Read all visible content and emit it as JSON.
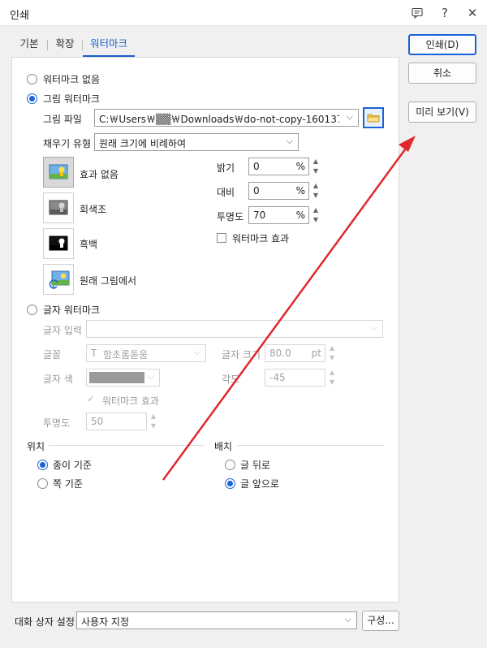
{
  "window": {
    "title": "인쇄"
  },
  "tabs": [
    {
      "label": "기본"
    },
    {
      "label": "확장"
    },
    {
      "label": "워터마크"
    }
  ],
  "watermark": {
    "none_label": "워터마크 없음",
    "image_label": "그림 워터마크",
    "image_file_label": "그림 파일",
    "image_file_value": "C:￦Users￦▒▒￦Downloads￦do-not-copy-160137…",
    "fill_type_label": "채우기 유형",
    "fill_type_value": "원래 크기에 비례하여",
    "effects": [
      {
        "label": "효과 없음"
      },
      {
        "label": "회색조"
      },
      {
        "label": "흑백"
      },
      {
        "label": "원래 그림에서"
      }
    ],
    "brightness_label": "밝기",
    "brightness_value": "0",
    "contrast_label": "대비",
    "contrast_value": "0",
    "transparency_label": "투명도",
    "transparency_value": "70",
    "percent": "%",
    "image_effect_label": "워터마크 효과",
    "text_label": "글자 워터마크",
    "text_input_label": "글자 입력",
    "font_label": "글꼴",
    "font_value": "함초롬돋움",
    "font_size_label": "글자 크기",
    "font_size_value": "80.0",
    "font_size_unit": "pt",
    "color_label": "글자 색",
    "angle_label": "각도",
    "angle_value": "-45",
    "text_effect_label": "워터마크 효과",
    "text_transparency_label": "투명도",
    "text_transparency_value": "50"
  },
  "position": {
    "title": "위치",
    "paper": "종이 기준",
    "page": "쪽 기준"
  },
  "placement": {
    "title": "배치",
    "behind": "글 뒤로",
    "front": "글 앞으로"
  },
  "dialog_setting": {
    "label": "대화 상자 설정",
    "value": "사용자 지정",
    "config_button": "구성..."
  },
  "buttons": {
    "print": "인쇄(D)",
    "cancel": "취소",
    "preview": "미리 보기(V)"
  },
  "colors": {
    "accent": "#1a63d6",
    "annotation_arrow": "#e0282e"
  }
}
